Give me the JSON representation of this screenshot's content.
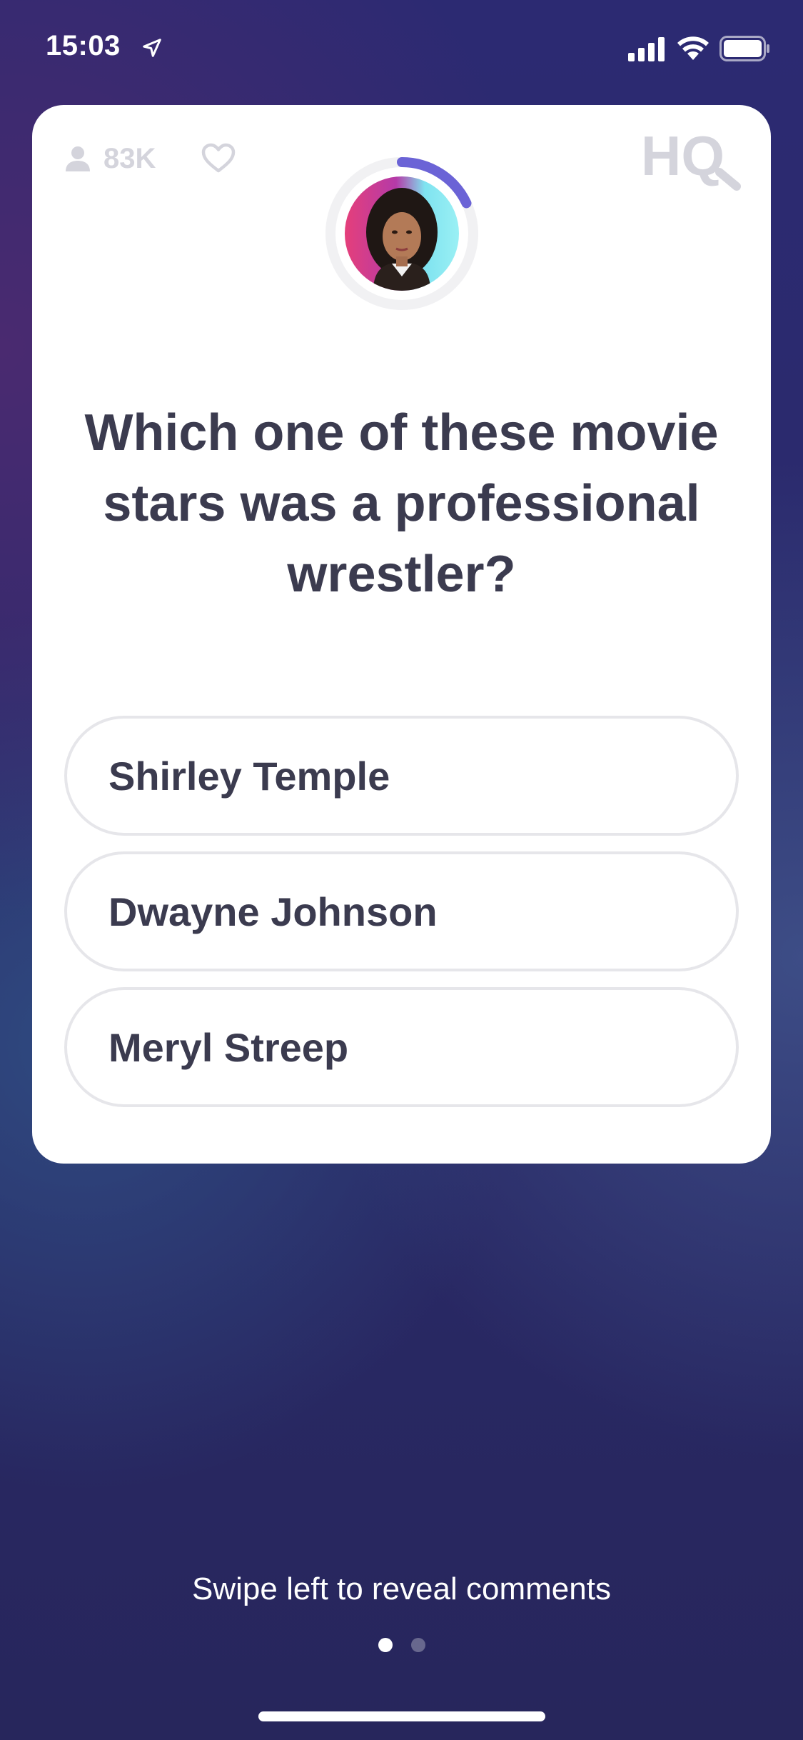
{
  "status_bar": {
    "time": "15:03",
    "icons": [
      "location-arrow-icon",
      "cellular-signal-icon",
      "wifi-icon",
      "battery-icon"
    ]
  },
  "card": {
    "viewer_count": "83K",
    "logo_text": "HQ",
    "question": "Which one of these movie stars was a professional wrestler?",
    "answers": [
      {
        "label": "Shirley Temple"
      },
      {
        "label": "Dwayne Johnson"
      },
      {
        "label": "Meryl Streep"
      }
    ],
    "timer_progress": 0.18
  },
  "footer": {
    "swipe_hint": "Swipe left to reveal comments",
    "pages": 2,
    "active_page": 1
  },
  "colors": {
    "accent": "#6b63d6",
    "text": "#3b3b4f",
    "muted": "#d4d4dc",
    "border": "#e6e6ea"
  }
}
